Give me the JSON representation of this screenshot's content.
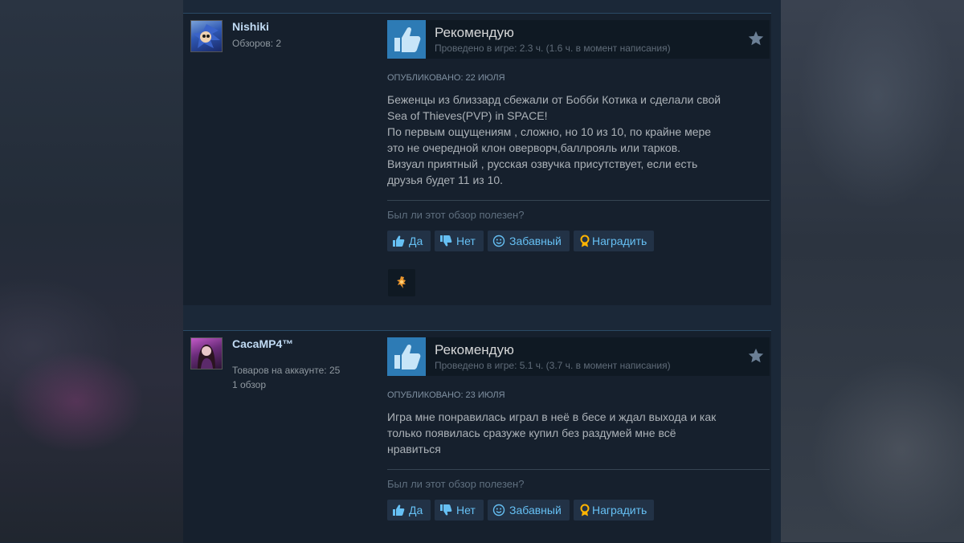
{
  "reviews": [
    {
      "author": {
        "name": "Nishiki",
        "stats": [
          "Обзоров: 2"
        ]
      },
      "verdict": "Рекомендую",
      "playtime": "Проведено в игре: 2.3 ч. (1.6 ч. в момент написания)",
      "posted": "Опубликовано: 22 июля",
      "text_lines": [
        "Беженцы из близзард сбежали от Бобби Котика и сделали свой",
        "Sea of Thieves(PVP) in SPACE!",
        "По первым ощущениям , сложно, но 10 из 10, по крайне мере",
        "это не очередной клон оверворч,баллрояль или тарков.",
        "Визуал приятный , русская озвучка присутствует, если есть",
        "друзья будет 11 из 10."
      ],
      "helpful_question": "Был ли этот обзор полезен?",
      "buttons": {
        "yes": "Да",
        "no": "Нет",
        "funny": "Забавный",
        "award": "Наградить"
      },
      "has_award": true
    },
    {
      "author": {
        "name": "CacaMP4™",
        "stats": [
          "Товаров на аккаунте: 25",
          "1 обзор"
        ]
      },
      "verdict": "Рекомендую",
      "playtime": "Проведено в игре: 5.1 ч. (3.7 ч. в момент написания)",
      "posted": "Опубликовано: 23 июля",
      "text_lines": [
        "Игра мне понравилась играл в неё в бесе и ждал выхода и как",
        "только появилась сразуже купил без раздумей мне всё",
        "нравиться"
      ],
      "helpful_question": "Был ли этот обзор полезен?",
      "buttons": {
        "yes": "Да",
        "no": "Нет",
        "funny": "Забавный",
        "award": "Наградить"
      },
      "has_award": false
    }
  ],
  "colors": {
    "accent": "#66c0f4",
    "thumb_bg": "#2d7bb5",
    "award": "#ffb400"
  }
}
